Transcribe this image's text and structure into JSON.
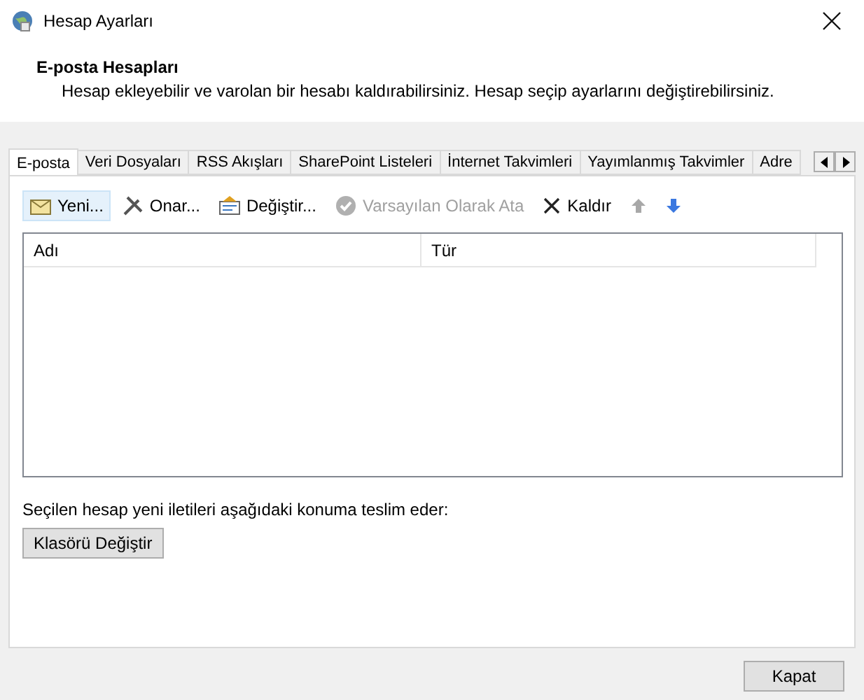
{
  "window": {
    "title": "Hesap Ayarları"
  },
  "header": {
    "title": "E-posta Hesapları",
    "description": "Hesap ekleyebilir ve varolan bir hesabı kaldırabilirsiniz. Hesap seçip ayarlarını değiştirebilirsiniz."
  },
  "tabs": [
    {
      "label": "E-posta",
      "selected": true
    },
    {
      "label": "Veri Dosyaları",
      "selected": false
    },
    {
      "label": "RSS Akışları",
      "selected": false
    },
    {
      "label": "SharePoint Listeleri",
      "selected": false
    },
    {
      "label": "İnternet Takvimleri",
      "selected": false
    },
    {
      "label": "Yayımlanmış Takvimler",
      "selected": false
    },
    {
      "label": "Adre",
      "selected": false
    }
  ],
  "toolbar": [
    {
      "kind": "new",
      "label": "Yeni...",
      "highlighted": true,
      "disabled": false
    },
    {
      "kind": "repair",
      "label": "Onar...",
      "highlighted": false,
      "disabled": false
    },
    {
      "kind": "change",
      "label": "Değiştir...",
      "highlighted": false,
      "disabled": false
    },
    {
      "kind": "default",
      "label": "Varsayılan Olarak Ata",
      "highlighted": false,
      "disabled": true
    },
    {
      "kind": "remove",
      "label": "Kaldır",
      "highlighted": false,
      "disabled": false
    },
    {
      "kind": "up",
      "highlighted": false,
      "disabled": true
    },
    {
      "kind": "down",
      "highlighted": false,
      "disabled": false
    }
  ],
  "table": {
    "columns": [
      "Adı",
      "Tür"
    ]
  },
  "delivery": {
    "text": "Seçilen hesap yeni iletileri aşağıdaki konuma teslim eder:",
    "button": "Klasörü Değiştir"
  },
  "buttons": [
    "Kapat"
  ]
}
